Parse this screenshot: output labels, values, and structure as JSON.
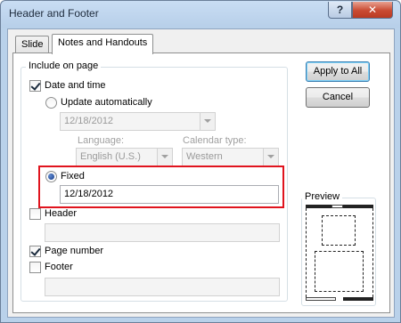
{
  "window": {
    "title": "Header and Footer",
    "help_label": "?",
    "close_label": "✕"
  },
  "tabs": [
    {
      "label": "Slide",
      "active": false
    },
    {
      "label": "Notes and Handouts",
      "active": true
    }
  ],
  "include_group": {
    "label": "Include on page",
    "date_time": {
      "label": "Date and time",
      "checked": true
    },
    "update_auto": {
      "label": "Update automatically",
      "selected": false,
      "value": "12/18/2012"
    },
    "language": {
      "label": "Language:",
      "value": "English (U.S.)"
    },
    "calendar": {
      "label": "Calendar type:",
      "value": "Western"
    },
    "fixed": {
      "label": "Fixed",
      "selected": true,
      "value": "12/18/2012"
    },
    "header": {
      "label": "Header",
      "checked": false,
      "value": ""
    },
    "page_number": {
      "label": "Page number",
      "checked": true
    },
    "footer": {
      "label": "Footer",
      "checked": false,
      "value": ""
    }
  },
  "buttons": {
    "apply_all": "Apply to All",
    "cancel": "Cancel"
  },
  "preview": {
    "label": "Preview"
  },
  "colors": {
    "highlight": "#e0141e",
    "title_bar": "#b9d1ea"
  }
}
